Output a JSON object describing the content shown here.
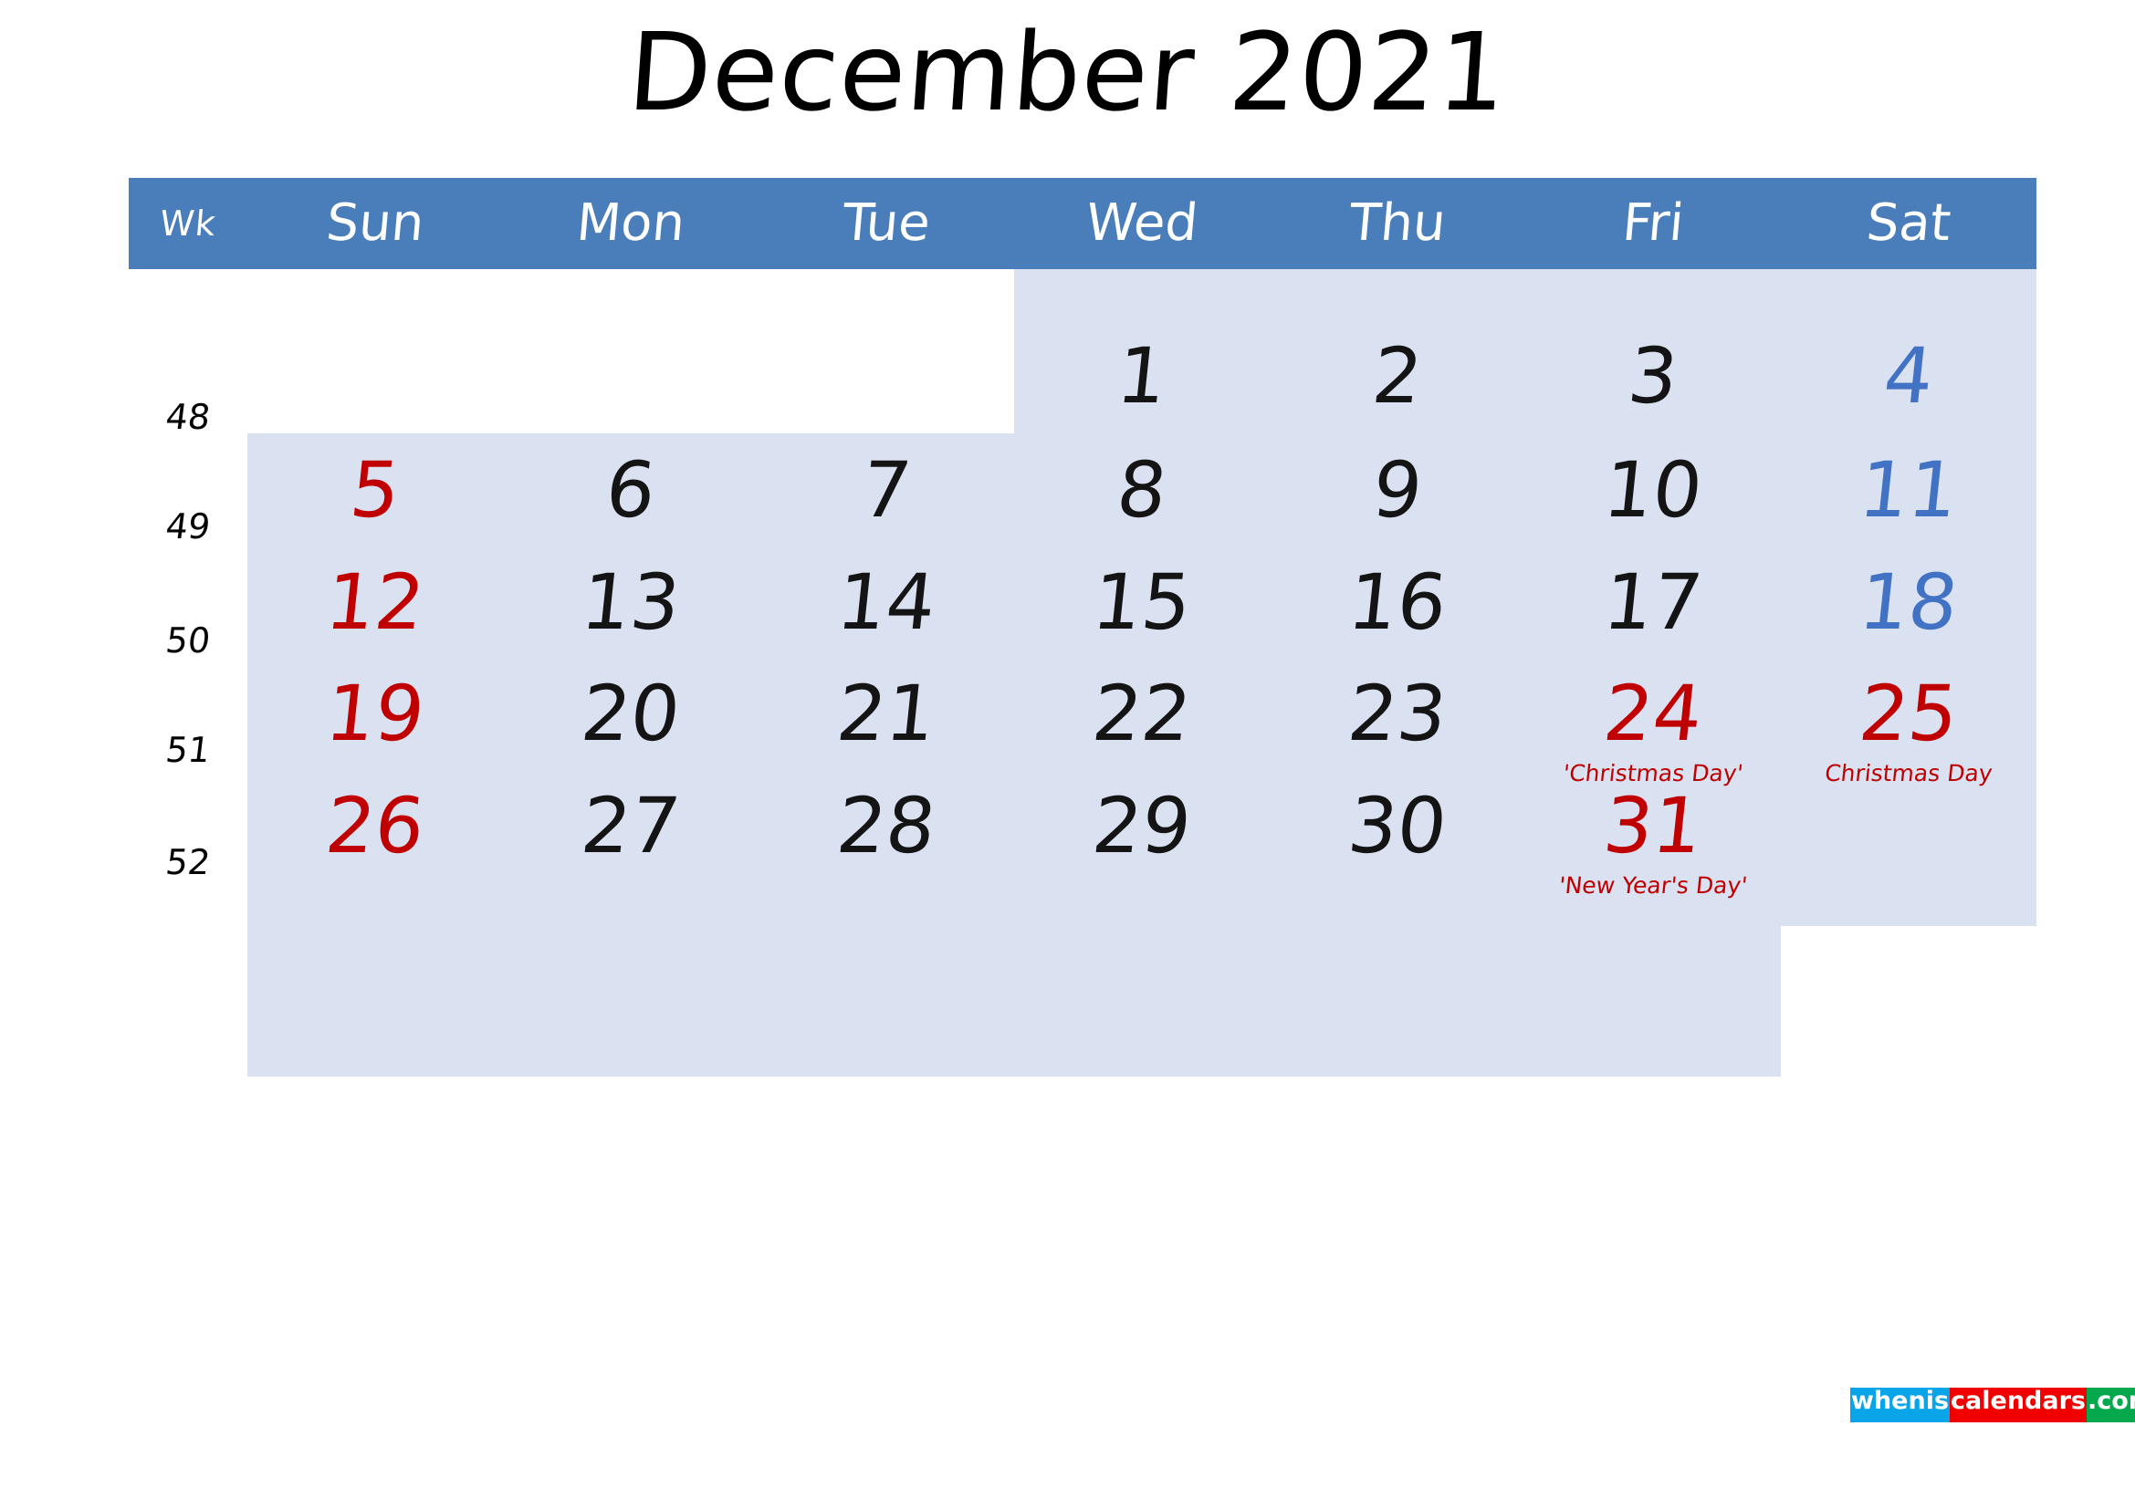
{
  "title": "December 2021",
  "colors": {
    "header_bg": "#4a7ebb",
    "cell_bg": "#dae1f0",
    "sunday": "#c00000",
    "saturday": "#4272c4",
    "holiday": "#c00000",
    "weekday": "#141414",
    "page_bg": "#ffffff"
  },
  "header": {
    "week_label": "Wk",
    "days": [
      "Sun",
      "Mon",
      "Tue",
      "Wed",
      "Thu",
      "Fri",
      "Sat"
    ]
  },
  "weeks": [
    {
      "week_number": "48",
      "days": [
        {
          "num": "",
          "kind": "empty",
          "event": ""
        },
        {
          "num": "",
          "kind": "empty",
          "event": ""
        },
        {
          "num": "",
          "kind": "empty",
          "event": ""
        },
        {
          "num": "1",
          "kind": "weekday",
          "event": ""
        },
        {
          "num": "2",
          "kind": "weekday",
          "event": ""
        },
        {
          "num": "3",
          "kind": "weekday",
          "event": ""
        },
        {
          "num": "4",
          "kind": "saturday",
          "event": ""
        }
      ]
    },
    {
      "week_number": "49",
      "days": [
        {
          "num": "5",
          "kind": "sunday",
          "event": ""
        },
        {
          "num": "6",
          "kind": "weekday",
          "event": ""
        },
        {
          "num": "7",
          "kind": "weekday",
          "event": ""
        },
        {
          "num": "8",
          "kind": "weekday",
          "event": ""
        },
        {
          "num": "9",
          "kind": "weekday",
          "event": ""
        },
        {
          "num": "10",
          "kind": "weekday",
          "event": ""
        },
        {
          "num": "11",
          "kind": "saturday",
          "event": ""
        }
      ]
    },
    {
      "week_number": "50",
      "days": [
        {
          "num": "12",
          "kind": "sunday",
          "event": ""
        },
        {
          "num": "13",
          "kind": "weekday",
          "event": ""
        },
        {
          "num": "14",
          "kind": "weekday",
          "event": ""
        },
        {
          "num": "15",
          "kind": "weekday",
          "event": ""
        },
        {
          "num": "16",
          "kind": "weekday",
          "event": ""
        },
        {
          "num": "17",
          "kind": "weekday",
          "event": ""
        },
        {
          "num": "18",
          "kind": "saturday",
          "event": ""
        }
      ]
    },
    {
      "week_number": "51",
      "days": [
        {
          "num": "19",
          "kind": "sunday",
          "event": ""
        },
        {
          "num": "20",
          "kind": "weekday",
          "event": ""
        },
        {
          "num": "21",
          "kind": "weekday",
          "event": ""
        },
        {
          "num": "22",
          "kind": "weekday",
          "event": ""
        },
        {
          "num": "23",
          "kind": "weekday",
          "event": ""
        },
        {
          "num": "24",
          "kind": "holiday",
          "event": "'Christmas Day'"
        },
        {
          "num": "25",
          "kind": "holiday",
          "event": "Christmas Day"
        }
      ]
    },
    {
      "week_number": "52",
      "days": [
        {
          "num": "26",
          "kind": "sunday",
          "event": ""
        },
        {
          "num": "27",
          "kind": "weekday",
          "event": ""
        },
        {
          "num": "28",
          "kind": "weekday",
          "event": ""
        },
        {
          "num": "29",
          "kind": "weekday",
          "event": ""
        },
        {
          "num": "30",
          "kind": "weekday",
          "event": ""
        },
        {
          "num": "31",
          "kind": "holiday",
          "event": "'New Year's Day'"
        },
        {
          "num": "",
          "kind": "empty",
          "event": ""
        }
      ]
    }
  ],
  "watermark": {
    "part1": "whenis",
    "part2": "calendars",
    "part3": ".com"
  }
}
